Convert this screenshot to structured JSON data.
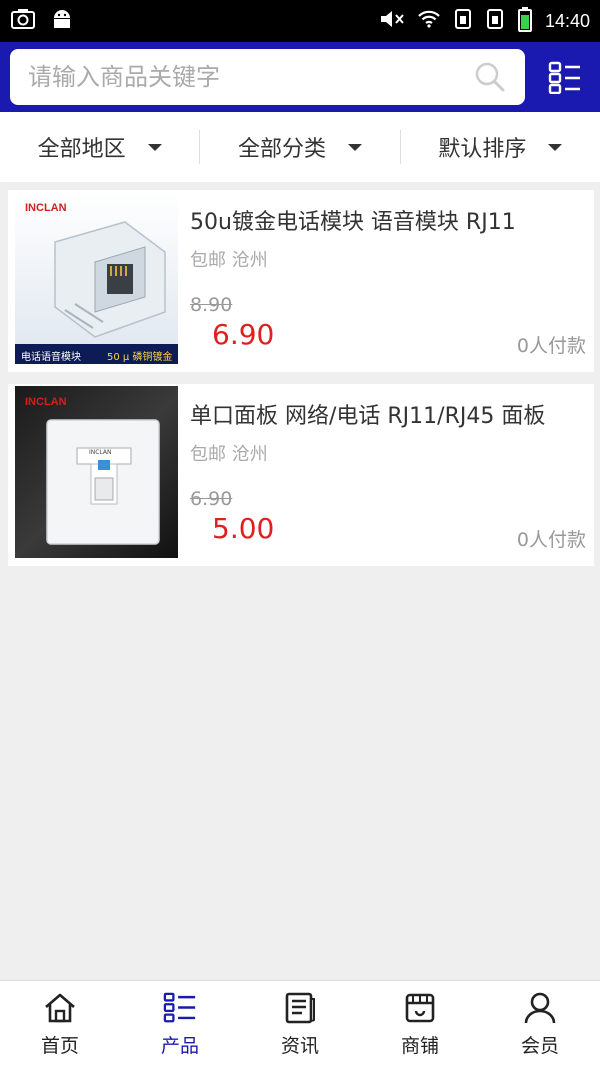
{
  "status_bar": {
    "time": "14:40"
  },
  "search": {
    "placeholder": "请输入商品关键字"
  },
  "filters": [
    {
      "label": "全部地区"
    },
    {
      "label": "全部分类"
    },
    {
      "label": "默认排序"
    }
  ],
  "products": [
    {
      "title": "50u镀金电话模块 语音模块 RJ11",
      "image_brand": "INCLAN",
      "image_caption": "电话语音模块",
      "image_caption2": "50 μ 磷铜镀金",
      "meta": "包邮 沧州",
      "old_price": "8.90",
      "price": "6.90",
      "sold": "0人付款"
    },
    {
      "title": "单口面板 网络/电话 RJ11/RJ45 面板",
      "image_brand": "INCLAN",
      "image_label": "INCLAN",
      "meta": "包邮 沧州",
      "old_price": "6.90",
      "price": "5.00",
      "sold": "0人付款"
    }
  ],
  "nav": [
    {
      "label": "首页",
      "icon": "home-icon"
    },
    {
      "label": "产品",
      "icon": "product-list-icon",
      "active": true
    },
    {
      "label": "资讯",
      "icon": "news-icon"
    },
    {
      "label": "商铺",
      "icon": "shop-icon"
    },
    {
      "label": "会员",
      "icon": "member-icon"
    }
  ],
  "colors": {
    "primary": "#1a1ab0",
    "price": "#e02020"
  }
}
